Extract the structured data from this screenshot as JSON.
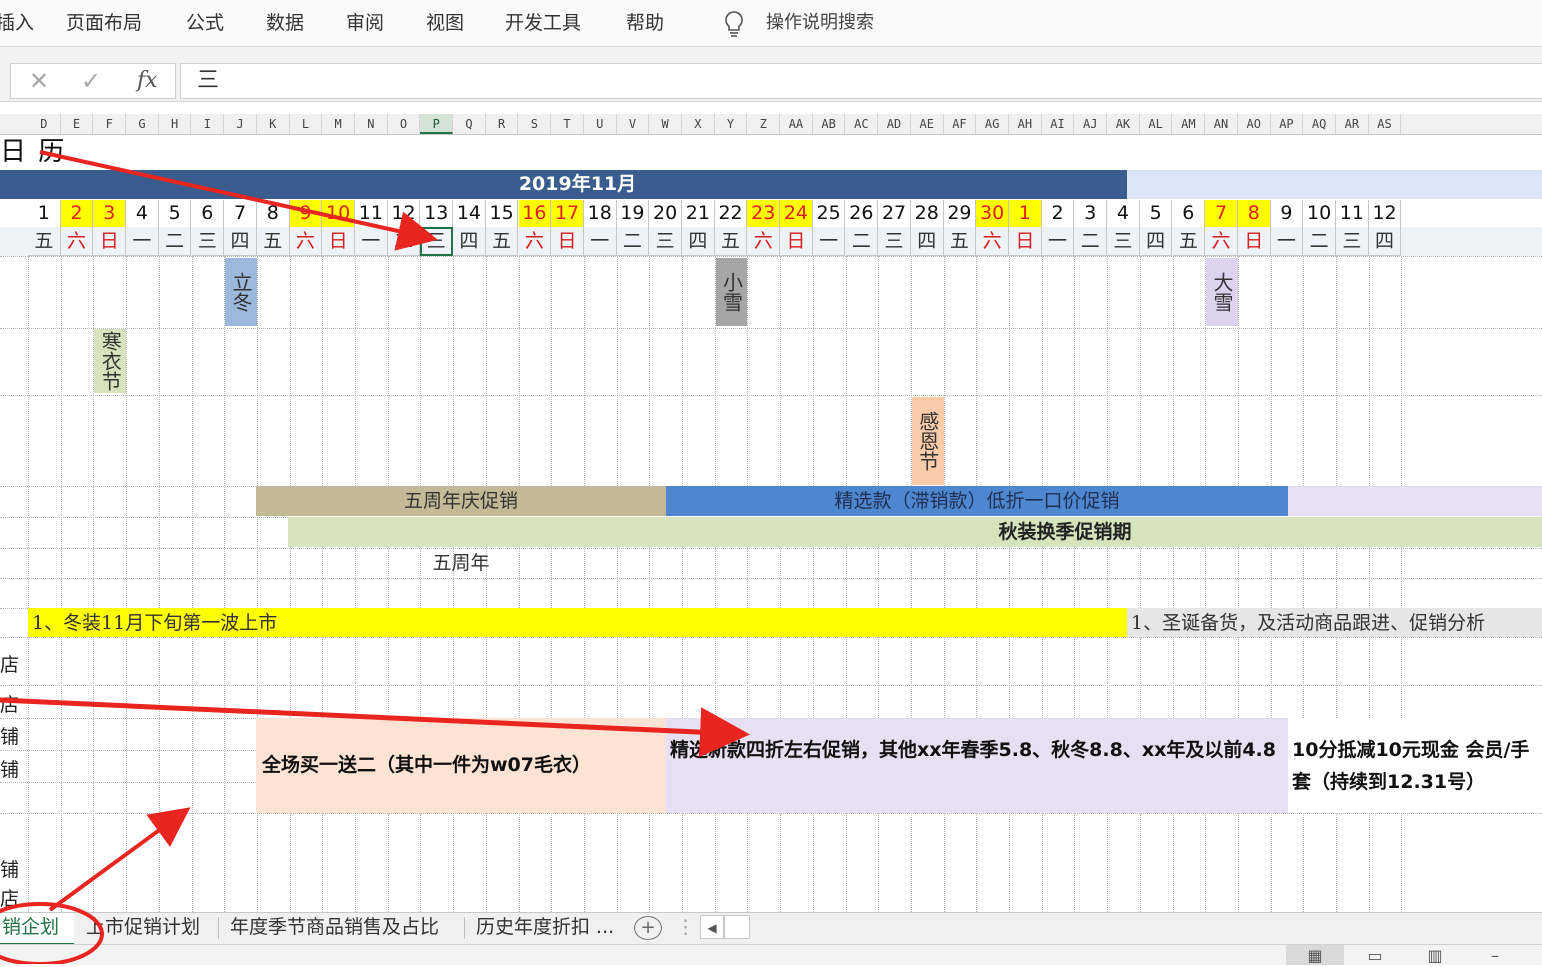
{
  "ribbon": {
    "tabs": [
      "插入",
      "页面布局",
      "公式",
      "数据",
      "审阅",
      "视图",
      "开发工具",
      "帮助"
    ],
    "search_label": "操作说明搜索"
  },
  "formula_bar": {
    "cancel_glyph": "✕",
    "confirm_glyph": "✓",
    "fx_label": "fx",
    "value": "三"
  },
  "columns": [
    "D",
    "E",
    "F",
    "G",
    "H",
    "I",
    "J",
    "K",
    "L",
    "M",
    "N",
    "O",
    "P",
    "Q",
    "R",
    "S",
    "T",
    "U",
    "V",
    "W",
    "X",
    "Y",
    "Z",
    "AA",
    "AB",
    "AC",
    "AD",
    "AE",
    "AF",
    "AG",
    "AH",
    "AI",
    "AJ",
    "AK",
    "AL",
    "AM",
    "AN",
    "AO",
    "AP",
    "AQ",
    "AR",
    "AS"
  ],
  "selected_column": "P",
  "sheet_title": "日 历",
  "month_header": "2019年11月",
  "days": [
    "1",
    "2",
    "3",
    "4",
    "5",
    "6",
    "7",
    "8",
    "9",
    "10",
    "11",
    "12",
    "13",
    "14",
    "15",
    "16",
    "17",
    "18",
    "19",
    "20",
    "21",
    "22",
    "23",
    "24",
    "25",
    "26",
    "27",
    "28",
    "29",
    "30",
    "1",
    "2",
    "3",
    "4",
    "5",
    "6",
    "7",
    "8",
    "9",
    "10",
    "11",
    "12"
  ],
  "weekdays": [
    "五",
    "六",
    "日",
    "一",
    "二",
    "三",
    "四",
    "五",
    "六",
    "日",
    "一",
    "二",
    "三",
    "四",
    "五",
    "六",
    "日",
    "一",
    "二",
    "三",
    "四",
    "五",
    "六",
    "日",
    "一",
    "二",
    "三",
    "四",
    "五",
    "六",
    "日",
    "一",
    "二",
    "三",
    "四",
    "五",
    "六",
    "日",
    "一",
    "二",
    "三",
    "四"
  ],
  "weekend_indices": [
    1,
    2,
    8,
    9,
    15,
    16,
    22,
    23,
    29,
    30,
    36,
    37
  ],
  "selected_weekday_index": 12,
  "solar_terms": [
    {
      "text": "立冬",
      "col": 6,
      "row": "a",
      "color": "#9cb8dc"
    },
    {
      "text": "小雪",
      "col": 21,
      "row": "a",
      "color": "#a6a6a6"
    },
    {
      "text": "大雪",
      "col": 36,
      "row": "a",
      "color": "#ddd3ee"
    },
    {
      "text": "寒衣节",
      "col": 2,
      "row": "b",
      "color": "#d7e3bd"
    },
    {
      "text": "感恩节",
      "col": 27,
      "row": "c",
      "color": "#f9cba9"
    }
  ],
  "promotions": {
    "anniversary": "五周年庆促销",
    "selected_low": "精选款（滞销款）低折一口价促销",
    "autumn_season": "秋装换季促销期",
    "anniversary_note": "五周年",
    "new_arrival_note": "1、冬装11月下旬第一波上市",
    "xmas_note": "1、圣诞备货，及活动商品跟进、促销分析",
    "buy_one_get_two": "全场买一送二（其中一件为w07毛衣）",
    "discount_detail": "精选新款四折左右促销，其他xx年春季5.8、秋冬8.8、xx年及以前4.8",
    "points_offer": "10分抵减10元现金  会员/手套（持续到12.31号）"
  },
  "row_labels": [
    "店",
    "店",
    "铺",
    "铺",
    "铺",
    "店"
  ],
  "sheet_tabs": [
    "销企划",
    "上市促销计划",
    "年度季节商品销售及占比",
    "历史年度折扣 ..."
  ],
  "active_sheet_index": 0,
  "add_sheet_glyph": "+",
  "scroll_left_glyph": "◀",
  "view_buttons": [
    "▦",
    "▭",
    "▥",
    "–"
  ],
  "colors": {
    "excel_green": "#217346",
    "month_bar": "#3a5c8e",
    "weekend_highlight": "#ffff00",
    "weekend_text": "#e02020",
    "annotation_red": "#e8251f"
  }
}
